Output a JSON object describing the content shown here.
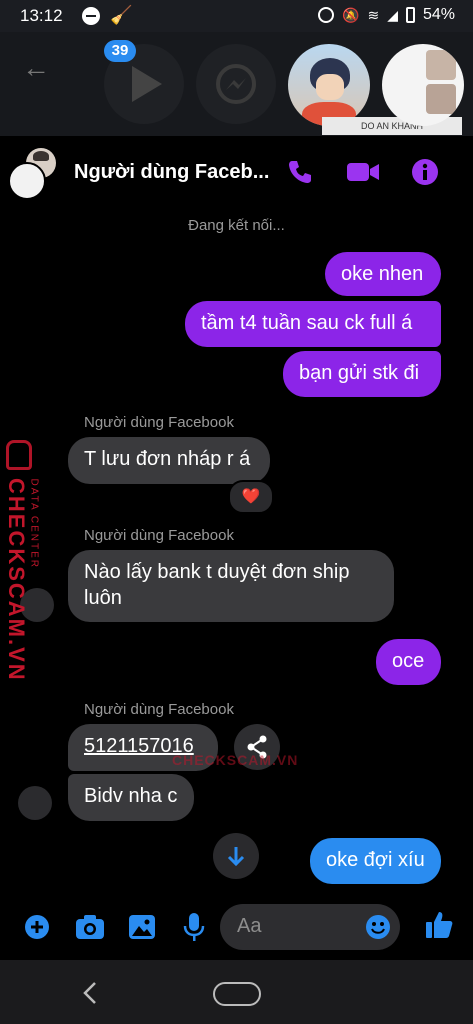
{
  "status_bar": {
    "time": "13:12",
    "battery": "54%"
  },
  "chat_heads": {
    "badge_count": "39",
    "avatar_caption": "DO AN KHANH"
  },
  "header": {
    "name": "Người dùng Faceb..."
  },
  "connection_status": "Đang kết nối...",
  "messages": {
    "m1": "oke nhen",
    "m2": "tầm t4 tuần sau ck full á",
    "m3": "bạn gửi stk đi",
    "sender1": "Người dùng Facebook",
    "m4": "T lưu đơn nháp r á",
    "reaction": "❤️",
    "sender2": "Người dùng Facebook",
    "m5": "Nào lấy bank t duyệt đơn ship luôn",
    "m6": "oce",
    "sender3": "Người dùng Facebook",
    "m7": "5121157016",
    "m8": "Bidv nha c",
    "m9": "oke đợi xíu"
  },
  "composer": {
    "placeholder": "Aa"
  },
  "watermark": {
    "brand": "CHECKSCAM.VN",
    "sub": "DATA CENTER"
  },
  "colors": {
    "accent": "#8c25e8",
    "blue": "#2a8cf0",
    "incoming": "#3a3a3d"
  }
}
